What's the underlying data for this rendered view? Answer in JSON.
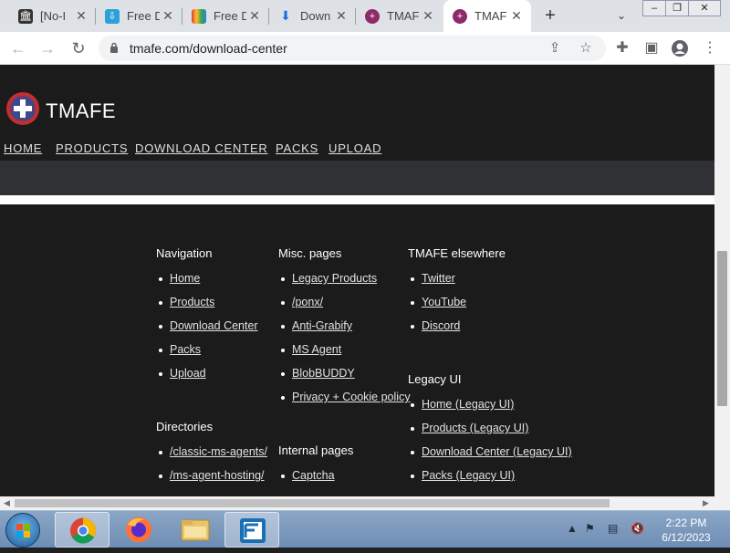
{
  "browser": {
    "tabs": [
      {
        "label": "[No-I",
        "icon": "archive-icon"
      },
      {
        "label": "Free D",
        "icon": "freedl-icon"
      },
      {
        "label": "Free D",
        "icon": "rainbow-icon"
      },
      {
        "label": "Down",
        "icon": "download-icon"
      },
      {
        "label": "TMAF",
        "icon": "tmafe-icon"
      },
      {
        "label": "TMAF",
        "icon": "tmafe-icon"
      }
    ],
    "url": "tmafe.com/download-center",
    "window_controls": [
      "minimize",
      "restore",
      "close"
    ]
  },
  "site": {
    "brand": "TMAFE",
    "nav": [
      "HOME",
      "PRODUCTS",
      "DOWNLOAD CENTER",
      "PACKS",
      "UPLOAD"
    ]
  },
  "footer": {
    "navigation": {
      "heading": "Navigation",
      "links": [
        "Home",
        "Products",
        "Download Center",
        "Packs",
        "Upload"
      ]
    },
    "misc": {
      "heading": "Misc. pages",
      "links": [
        "Legacy Products",
        "/ponx/",
        "Anti-Grabify",
        "MS Agent",
        "BlobBUDDY",
        "Privacy + Cookie policy"
      ]
    },
    "elsewhere": {
      "heading": "TMAFE elsewhere",
      "links": [
        "Twitter",
        "YouTube",
        "Discord"
      ]
    },
    "legacy": {
      "heading": "Legacy UI",
      "links": [
        "Home (Legacy UI)",
        "Products (Legacy UI)",
        "Download Center (Legacy UI)",
        "Packs (Legacy UI)"
      ]
    },
    "directories": {
      "heading": "Directories",
      "links": [
        "/classic-ms-agents/",
        "/ms-agent-hosting/"
      ]
    },
    "internal": {
      "heading": "Internal pages",
      "links": [
        "Captcha"
      ]
    }
  },
  "taskbar": {
    "time": "2:22 PM",
    "date": "6/12/2023"
  },
  "colors": {
    "page_bg": "#1c1b1b",
    "band": "#303134",
    "taskbar": "#7b97bd"
  }
}
